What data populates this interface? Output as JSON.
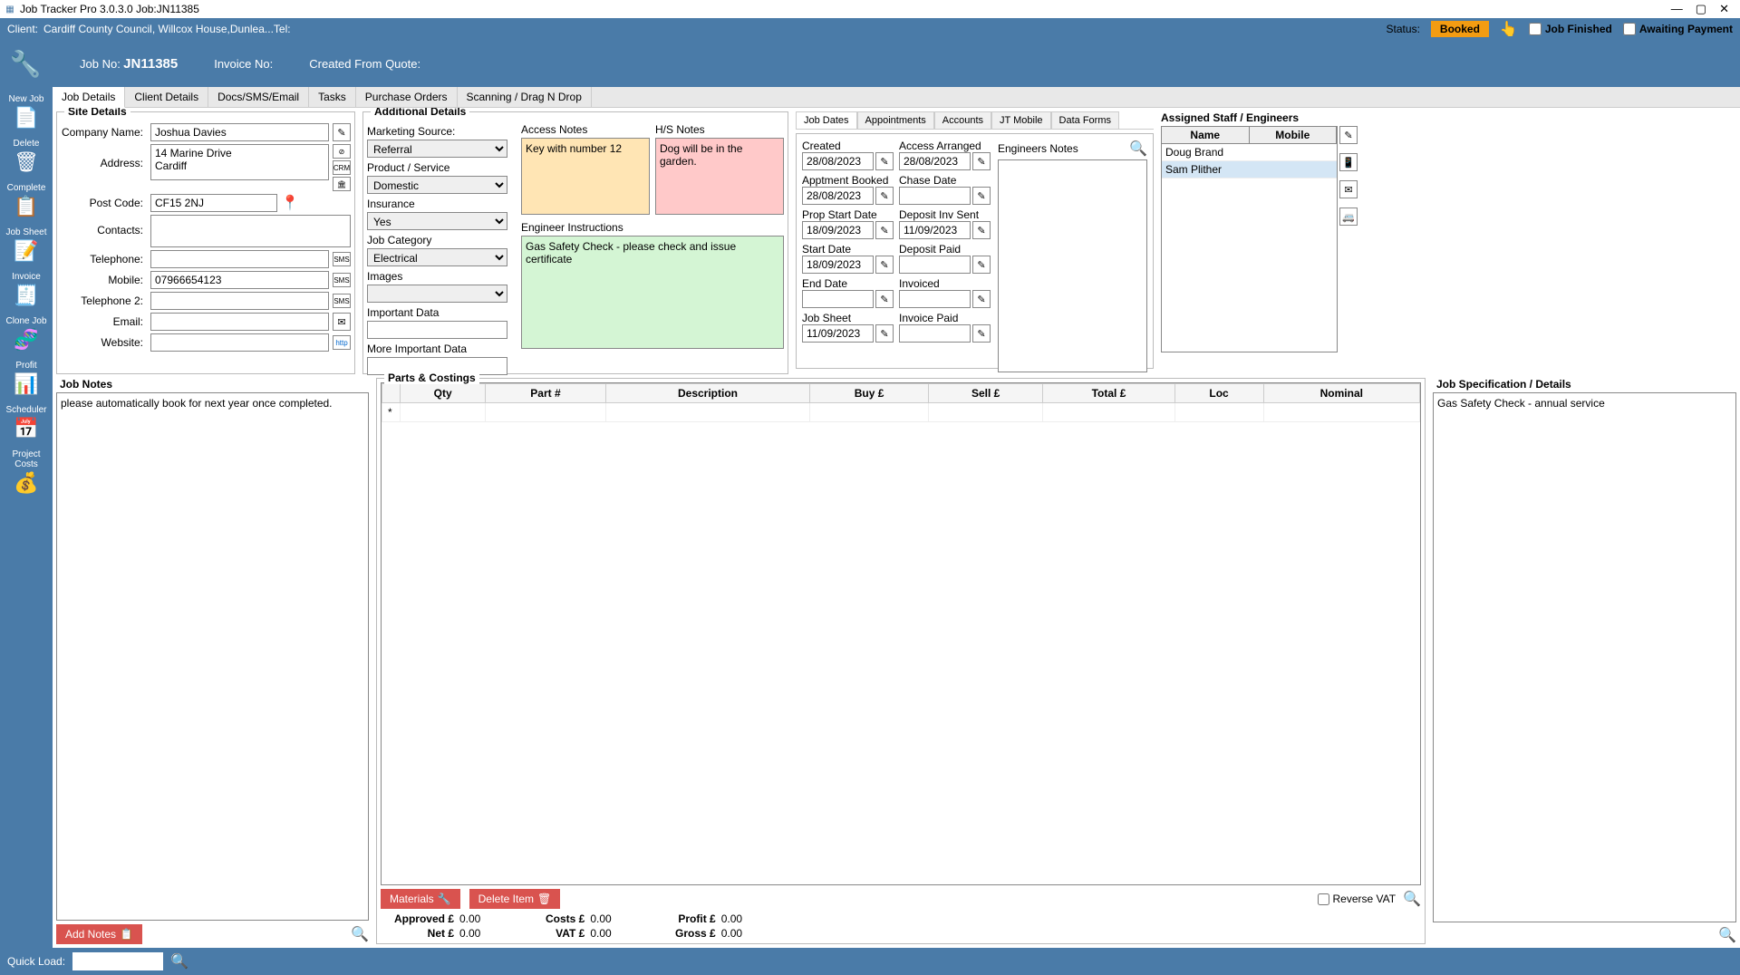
{
  "window": {
    "title": "Job Tracker Pro 3.0.3.0 Job:JN11385",
    "minimize": "—",
    "maximize": "▢",
    "close": "✕"
  },
  "header": {
    "client_label": "Client:",
    "client_value": "Cardiff County Council, Willcox House,Dunlea...Tel:",
    "status_label": "Status:",
    "status_value": "Booked",
    "job_finished": "Job Finished",
    "awaiting_payment": "Awaiting Payment"
  },
  "subheader": {
    "job_no_label": "Job No:",
    "job_no_value": "JN11385",
    "invoice_no_label": "Invoice No:",
    "invoice_no_value": "",
    "created_from_label": "Created From Quote:",
    "created_from_value": ""
  },
  "sidebar": {
    "new_job": "New Job",
    "delete": "Delete",
    "complete": "Complete",
    "job_sheet": "Job Sheet",
    "invoice": "Invoice",
    "clone_job": "Clone Job",
    "profit": "Profit",
    "scheduler": "Scheduler",
    "project_costs": "Project Costs"
  },
  "tabs": {
    "job_details": "Job Details",
    "client_details": "Client Details",
    "docs": "Docs/SMS/Email",
    "tasks": "Tasks",
    "purchase_orders": "Purchase Orders",
    "scanning": "Scanning / Drag N Drop"
  },
  "site": {
    "title": "Site Details",
    "company_label": "Company Name:",
    "company_value": "Joshua Davies",
    "address_label": "Address:",
    "address_value": "14 Marine Drive\nCardiff",
    "postcode_label": "Post Code:",
    "postcode_value": "CF15 2NJ",
    "contacts_label": "Contacts:",
    "telephone_label": "Telephone:",
    "mobile_label": "Mobile:",
    "mobile_value": "07966654123",
    "telephone2_label": "Telephone 2:",
    "email_label": "Email:",
    "website_label": "Website:"
  },
  "additional": {
    "title": "Additional Details",
    "marketing_label": "Marketing Source:",
    "marketing_value": "Referral",
    "product_label": "Product / Service",
    "product_value": "Domestic",
    "insurance_label": "Insurance",
    "insurance_value": "Yes",
    "category_label": "Job Category",
    "category_value": "Electrical",
    "images_label": "Images",
    "important_label": "Important Data",
    "more_important_label": "More Important Data",
    "access_notes_label": "Access Notes",
    "access_notes_value": "Key with number 12",
    "hs_notes_label": "H/S Notes",
    "hs_notes_value": "Dog will be in the garden.",
    "engineer_inst_label": "Engineer Instructions",
    "engineer_inst_value": "Gas Safety Check - please check and issue certificate"
  },
  "dates": {
    "tabs": {
      "job_dates": "Job Dates",
      "appointments": "Appointments",
      "accounts": "Accounts",
      "jt_mobile": "JT Mobile",
      "data_forms": "Data Forms"
    },
    "created_label": "Created",
    "created_value": "28/08/2023",
    "apptment_label": "Apptment Booked",
    "apptment_value": "28/08/2023",
    "prop_start_label": "Prop Start Date",
    "prop_start_value": "18/09/2023",
    "start_label": "Start Date",
    "start_value": "18/09/2023",
    "end_label": "End Date",
    "end_value": "",
    "job_sheet_label": "Job Sheet",
    "job_sheet_value": "11/09/2023",
    "access_arranged_label": "Access Arranged",
    "access_arranged_value": "28/08/2023",
    "chase_label": "Chase Date",
    "chase_value": "",
    "deposit_sent_label": "Deposit Inv Sent",
    "deposit_sent_value": "11/09/2023",
    "deposit_paid_label": "Deposit Paid",
    "deposit_paid_value": "",
    "invoiced_label": "Invoiced",
    "invoiced_value": "",
    "invoice_paid_label": "Invoice Paid",
    "invoice_paid_value": "",
    "engineers_notes_label": "Engineers Notes"
  },
  "staff": {
    "title": "Assigned Staff / Engineers",
    "name_hdr": "Name",
    "mobile_hdr": "Mobile",
    "rows": [
      {
        "name": "Doug Brand",
        "mobile": ""
      },
      {
        "name": "Sam Plither",
        "mobile": ""
      }
    ]
  },
  "job_notes": {
    "title": "Job Notes",
    "value": "please automatically book for next year once completed.",
    "add_btn": "Add Notes"
  },
  "parts": {
    "title": "Parts & Costings",
    "headers": {
      "qty": "Qty",
      "part": "Part #",
      "desc": "Description",
      "buy": "Buy £",
      "sell": "Sell £",
      "total": "Total £",
      "loc": "Loc",
      "nominal": "Nominal"
    },
    "materials_btn": "Materials",
    "delete_btn": "Delete Item",
    "reverse_vat": "Reverse VAT",
    "totals": {
      "approved_label": "Approved £",
      "approved_value": "0.00",
      "net_label": "Net £",
      "net_value": "0.00",
      "costs_label": "Costs £",
      "costs_value": "0.00",
      "vat_label": "VAT £",
      "vat_value": "0.00",
      "profit_label": "Profit £",
      "profit_value": "0.00",
      "gross_label": "Gross £",
      "gross_value": "0.00"
    }
  },
  "spec": {
    "title": "Job Specification / Details",
    "value": "Gas Safety Check - annual service"
  },
  "bottom": {
    "quick_load_label": "Quick Load:"
  }
}
